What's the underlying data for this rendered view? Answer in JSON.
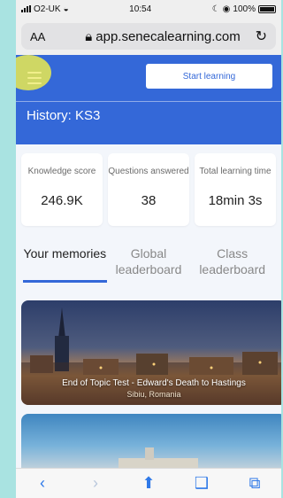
{
  "status": {
    "carrier": "O2-UK",
    "time": "10:54",
    "battery": "100%"
  },
  "browser": {
    "text_size": "AA",
    "url": "app.senecalearning.com"
  },
  "header": {
    "start_label": "Start learning",
    "subject": "History: KS3"
  },
  "stats": [
    {
      "label": "Knowledge score",
      "value": "246.9K"
    },
    {
      "label": "Questions answered",
      "value": "38"
    },
    {
      "label": "Total learning time",
      "value": "18min 3s"
    }
  ],
  "tabs": [
    {
      "label": "Your memories",
      "active": true
    },
    {
      "label": "Global leaderboard",
      "active": false
    },
    {
      "label": "Class leaderboard",
      "active": false
    }
  ],
  "cards": [
    {
      "title": "End of Topic Test - Edward's Death to Hastings",
      "place": "Sibiu, Romania"
    }
  ],
  "toolbar": [
    "back-icon",
    "forward-icon",
    "share-icon",
    "bookmarks-icon",
    "tabs-icon"
  ],
  "colors": {
    "brand": "#3468d8",
    "highlight": "#ebeb50"
  }
}
